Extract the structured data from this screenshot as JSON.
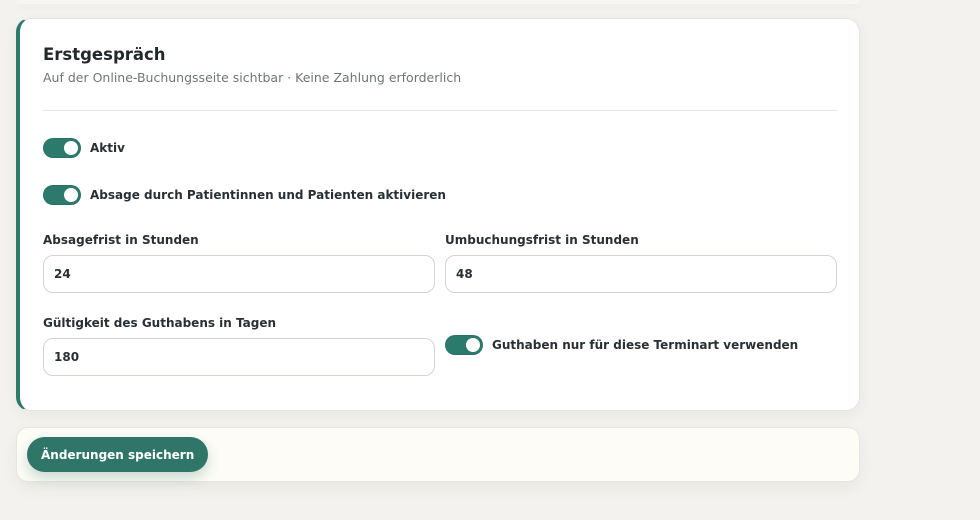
{
  "card": {
    "title": "Erstgespräch",
    "subtitle": "Auf der Online-Buchungsseite sichtbar · Keine Zahlung erforderlich"
  },
  "toggles": {
    "active": {
      "label": "Aktiv",
      "on": true
    },
    "patient_cancellation": {
      "label": "Absage durch Patientinnen und Patienten aktivieren",
      "on": true
    },
    "credit_only_this_type": {
      "label": "Guthaben nur für diese Terminart verwenden",
      "on": true
    }
  },
  "fields": {
    "cancellation_deadline": {
      "label": "Absagefrist in Stunden",
      "value": "24"
    },
    "rebooking_deadline": {
      "label": "Umbuchungsfrist in Stunden",
      "value": "48"
    },
    "credit_validity": {
      "label": "Gültigkeit des Guthabens in Tagen",
      "value": "180"
    }
  },
  "footer": {
    "save_label": "Änderungen speichern"
  },
  "colors": {
    "accent": "#2b7a6b",
    "background": "#f3f2ee",
    "card": "#ffffff"
  }
}
